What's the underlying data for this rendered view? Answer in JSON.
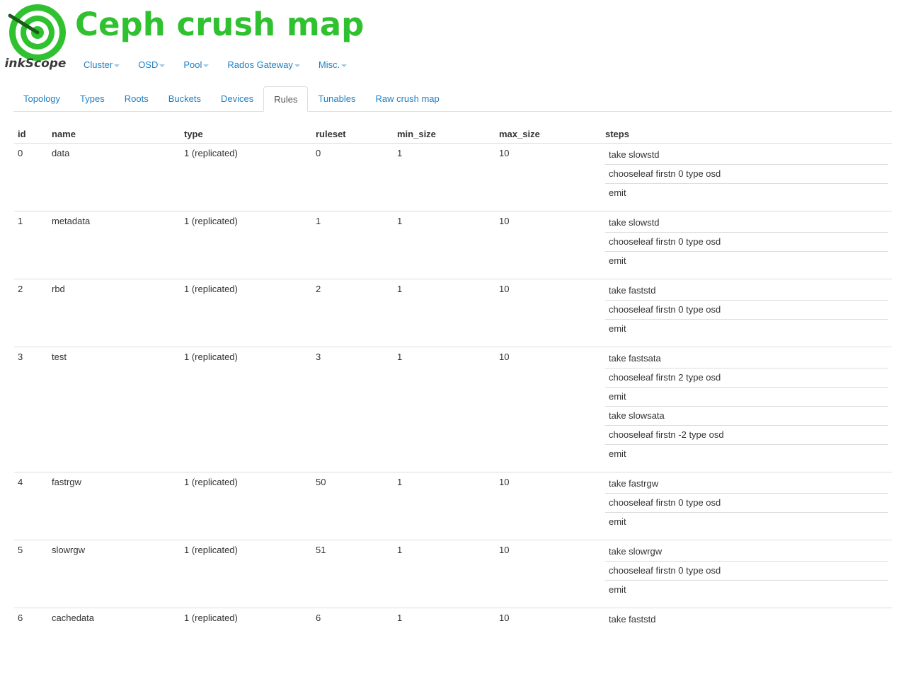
{
  "app": {
    "logo_text": "inkScope",
    "title": "Ceph crush map",
    "brand_color": "#2fc12f",
    "link_color": "#1e7fc4"
  },
  "topnav": [
    {
      "label": "Cluster",
      "icon": "caret-down-icon"
    },
    {
      "label": "OSD",
      "icon": "caret-down-icon"
    },
    {
      "label": "Pool",
      "icon": "caret-down-icon"
    },
    {
      "label": "Rados Gateway",
      "icon": "caret-down-icon"
    },
    {
      "label": "Misc.",
      "icon": "caret-down-icon"
    }
  ],
  "tabs": [
    {
      "label": "Topology",
      "active": false
    },
    {
      "label": "Types",
      "active": false
    },
    {
      "label": "Roots",
      "active": false
    },
    {
      "label": "Buckets",
      "active": false
    },
    {
      "label": "Devices",
      "active": false
    },
    {
      "label": "Rules",
      "active": true
    },
    {
      "label": "Tunables",
      "active": false
    },
    {
      "label": "Raw crush map",
      "active": false
    }
  ],
  "table": {
    "columns": [
      "id",
      "name",
      "type",
      "ruleset",
      "min_size",
      "max_size",
      "steps"
    ],
    "rows": [
      {
        "id": "0",
        "name": "data",
        "type": "1 (replicated)",
        "ruleset": "0",
        "min_size": "1",
        "max_size": "10",
        "steps": [
          "take slowstd",
          "chooseleaf firstn 0 type osd",
          "emit"
        ]
      },
      {
        "id": "1",
        "name": "metadata",
        "type": "1 (replicated)",
        "ruleset": "1",
        "min_size": "1",
        "max_size": "10",
        "steps": [
          "take slowstd",
          "chooseleaf firstn 0 type osd",
          "emit"
        ]
      },
      {
        "id": "2",
        "name": "rbd",
        "type": "1 (replicated)",
        "ruleset": "2",
        "min_size": "1",
        "max_size": "10",
        "steps": [
          "take faststd",
          "chooseleaf firstn 0 type osd",
          "emit"
        ]
      },
      {
        "id": "3",
        "name": "test",
        "type": "1 (replicated)",
        "ruleset": "3",
        "min_size": "1",
        "max_size": "10",
        "steps": [
          "take fastsata",
          "chooseleaf firstn 2 type osd",
          "emit",
          "take slowsata",
          "chooseleaf firstn -2 type osd",
          "emit"
        ]
      },
      {
        "id": "4",
        "name": "fastrgw",
        "type": "1 (replicated)",
        "ruleset": "50",
        "min_size": "1",
        "max_size": "10",
        "steps": [
          "take fastrgw",
          "chooseleaf firstn 0 type osd",
          "emit"
        ]
      },
      {
        "id": "5",
        "name": "slowrgw",
        "type": "1 (replicated)",
        "ruleset": "51",
        "min_size": "1",
        "max_size": "10",
        "steps": [
          "take slowrgw",
          "chooseleaf firstn 0 type osd",
          "emit"
        ]
      },
      {
        "id": "6",
        "name": "cachedata",
        "type": "1 (replicated)",
        "ruleset": "6",
        "min_size": "1",
        "max_size": "10",
        "steps": [
          "take faststd"
        ]
      }
    ]
  }
}
